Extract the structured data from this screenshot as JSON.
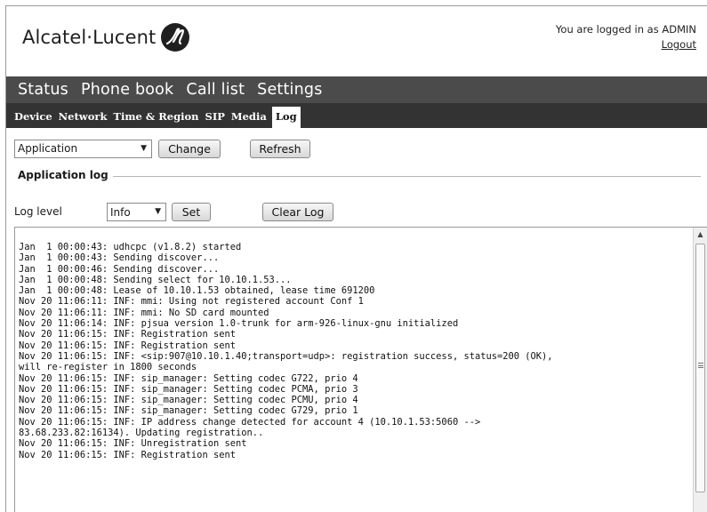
{
  "header": {
    "brand": "Alcatel·Lucent",
    "logo_icon": "alcatel-lucent-logo-icon",
    "logged_in_text": "You are logged in as ADMIN",
    "logout_label": "Logout"
  },
  "main_nav": {
    "items": [
      {
        "label": "Status"
      },
      {
        "label": "Phone book"
      },
      {
        "label": "Call list"
      },
      {
        "label": "Settings"
      }
    ]
  },
  "sub_nav": {
    "items": [
      {
        "label": "Device"
      },
      {
        "label": "Network"
      },
      {
        "label": "Time & Region"
      },
      {
        "label": "SIP"
      },
      {
        "label": "Media"
      },
      {
        "label": "Log",
        "active": true
      }
    ]
  },
  "controls": {
    "log_type_selected": "Application",
    "change_label": "Change",
    "refresh_label": "Refresh",
    "section_title": "Application log",
    "log_level_label": "Log level",
    "log_level_selected": "Info",
    "set_label": "Set",
    "clear_log_label": "Clear Log"
  },
  "log": {
    "lines": [
      "Jan  1 00:00:43: udhcpc (v1.8.2) started",
      "Jan  1 00:00:43: Sending discover...",
      "Jan  1 00:00:46: Sending discover...",
      "Jan  1 00:00:48: Sending select for 10.10.1.53...",
      "Jan  1 00:00:48: Lease of 10.10.1.53 obtained, lease time 691200",
      "Nov 20 11:06:11: INF: mmi: Using not registered account Conf 1",
      "Nov 20 11:06:11: INF: mmi: No SD card mounted",
      "Nov 20 11:06:14: INF: pjsua version 1.0-trunk for arm-926-linux-gnu initialized",
      "Nov 20 11:06:15: INF: Registration sent",
      "Nov 20 11:06:15: INF: Registration sent",
      "Nov 20 11:06:15: INF: <sip:907@10.10.1.40;transport=udp>: registration success, status=200 (OK),",
      "will re-register in 1800 seconds",
      "Nov 20 11:06:15: INF: sip_manager: Setting codec G722, prio 4",
      "Nov 20 11:06:15: INF: sip_manager: Setting codec PCMA, prio 3",
      "Nov 20 11:06:15: INF: sip_manager: Setting codec PCMU, prio 4",
      "Nov 20 11:06:15: INF: sip_manager: Setting codec G729, prio 1",
      "Nov 20 11:06:15: INF: IP address change detected for account 4 (10.10.1.53:5060 -->",
      "83.68.233.82:16134). Updating registration..",
      "Nov 20 11:06:15: INF: Unregistration sent",
      "Nov 20 11:06:15: INF: Registration sent"
    ]
  }
}
